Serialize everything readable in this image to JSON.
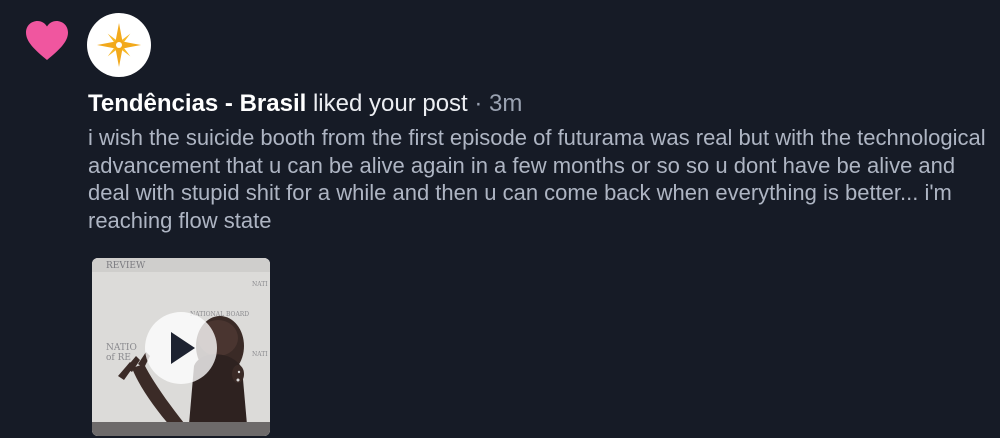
{
  "notification": {
    "author": "Tendências - Brasil",
    "action": " liked your post",
    "separator": " · ",
    "time": "3m",
    "post_text": "i wish the suicide booth from the first episode of futurama was real but with the technological advancement that u can be alive again in a few months or so so u dont have be alive and deal with stupid shit for a while and then u can come back when everything is better... i'm reaching flow state"
  },
  "icons": {
    "like": "heart-icon",
    "avatar": "compass-star-icon",
    "media_control": "play-icon"
  },
  "colors": {
    "background": "#161b26",
    "heart": "#f0569f",
    "avatar_star": "#f2a91c",
    "secondary_text": "#9aa2b1"
  }
}
